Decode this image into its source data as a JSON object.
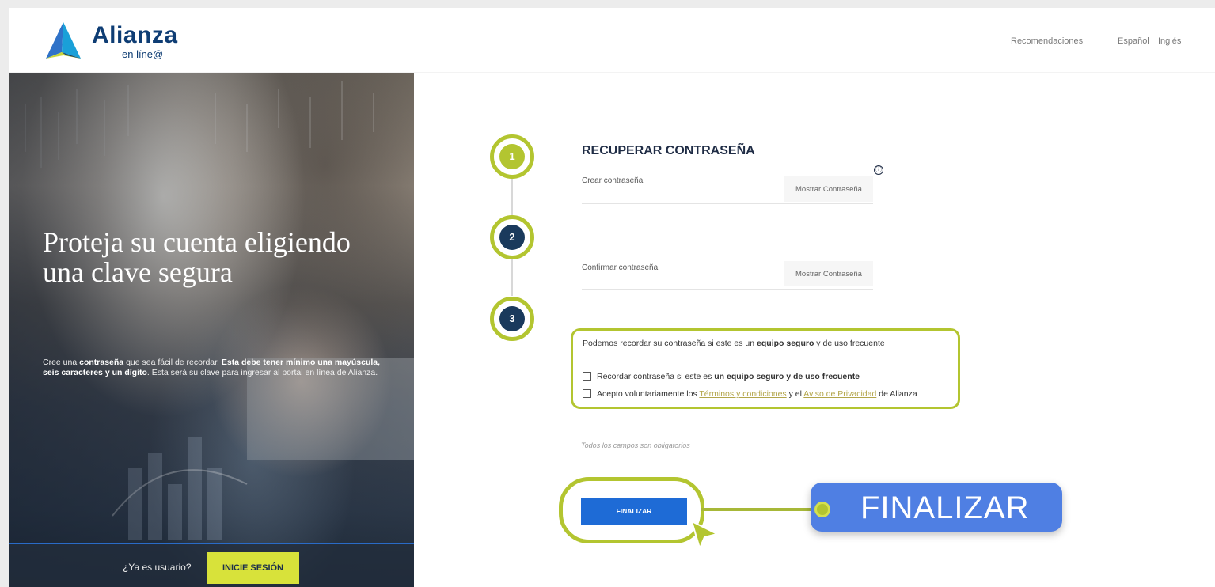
{
  "header": {
    "logo_name": "Alianza",
    "logo_sub": "en líne@",
    "nav_recommendations": "Recomendaciones",
    "lang_es": "Español",
    "lang_en": "Inglés"
  },
  "hero": {
    "title": "Proteja su cuenta eligiendo una clave segura",
    "text_1": "Cree una ",
    "text_2": "contraseña",
    "text_3": " que sea fácil de recordar. ",
    "text_4": "Esta debe tener mínimo una mayúscula, seis caracteres y un dígito",
    "text_5": ". Esta será su clave para ingresar al portal en línea de Alianza.",
    "footer_question": "¿Ya es usuario?",
    "login_button": "INICIE SESIÓN"
  },
  "steps": [
    "1",
    "2",
    "3"
  ],
  "form": {
    "title": "RECUPERAR CONTRASEÑA",
    "info_icon": "ⓘ",
    "create_label": "Crear contraseña",
    "show_password_1": "Mostrar Contraseña",
    "confirm_label": "Confirmar contraseña",
    "show_password_2": "Mostrar Contraseña",
    "remember_prefix": "Podemos recordar su contraseña si este es un ",
    "remember_bold": "equipo seguro",
    "remember_suffix": " y de uso frecuente",
    "check1_prefix": "Recordar contraseña si este es ",
    "check1_bold": "un equipo seguro y de uso frecuente",
    "check2_prefix": "Acepto voluntariamente los ",
    "check2_link1": "Términos y condiciones",
    "check2_mid": " y el ",
    "check2_link2": "Aviso de Privacidad",
    "check2_suffix": " de Alianza",
    "required_note": "Todos los campos son obligatorios",
    "finish_button": "FINALIZAR"
  },
  "callout": {
    "text": "FINALIZAR"
  },
  "colors": {
    "brand_navy": "#0e3d74",
    "highlight_green": "#b3c530",
    "primary_blue": "#1e6bd6",
    "callout_blue": "#4f7fe3",
    "login_yellow": "#d8e23a",
    "step1_fill": "#b3c530",
    "step_dark": "#1a3a5c"
  },
  "icons": {
    "logo": "alianza-triangle-logo",
    "info": "info-icon",
    "cursor": "arrow-cursor-icon"
  }
}
